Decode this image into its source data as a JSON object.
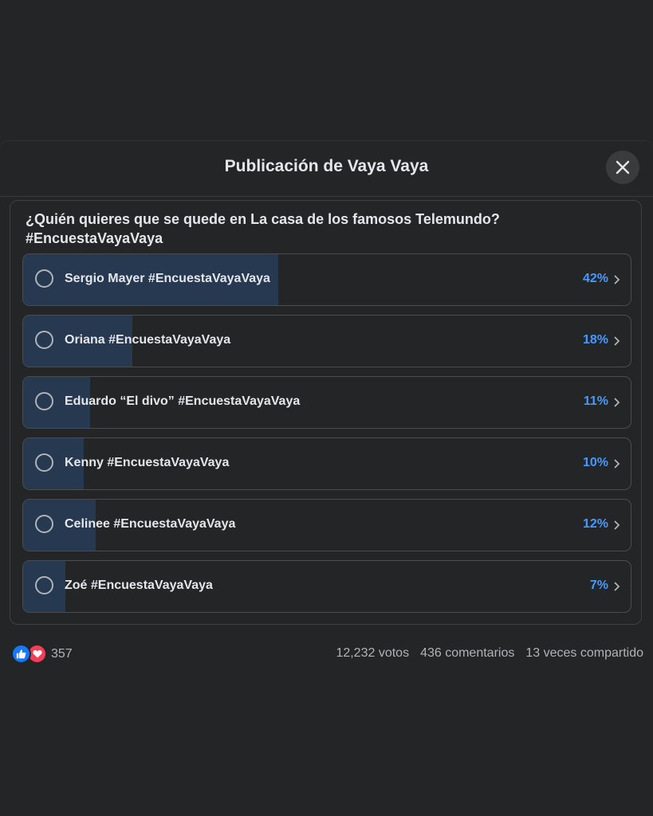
{
  "dialog": {
    "title": "Publicación de Vaya Vaya",
    "close_icon": "close-icon"
  },
  "poll": {
    "question": "¿Quién quieres que se quede en La casa de los famosos Telemundo? #EncuestaVayaVaya",
    "options": [
      {
        "label": "Sergio Mayer #EncuestaVayaVaya",
        "percent_text": "42%",
        "percent": 42
      },
      {
        "label": "Oriana #EncuestaVayaVaya",
        "percent_text": "18%",
        "percent": 18
      },
      {
        "label": "Eduardo “El divo” #EncuestaVayaVaya",
        "percent_text": "11%",
        "percent": 11
      },
      {
        "label": "Kenny #EncuestaVayaVaya",
        "percent_text": "10%",
        "percent": 10
      },
      {
        "label": "Celinee #EncuestaVayaVaya",
        "percent_text": "12%",
        "percent": 12
      },
      {
        "label": "Zoé #EncuestaVayaVaya",
        "percent_text": "7%",
        "percent": 7
      }
    ]
  },
  "footer": {
    "reactions_count": "357",
    "reaction_icons": [
      "like-icon",
      "love-icon"
    ],
    "votes": "12,232 votos",
    "comments": "436 comentarios",
    "shares": "13 veces compartido"
  },
  "colors": {
    "background": "#242526",
    "fill": "#263951",
    "accent": "#4599ff",
    "like": "#1877f2",
    "love": "#f33e58"
  }
}
